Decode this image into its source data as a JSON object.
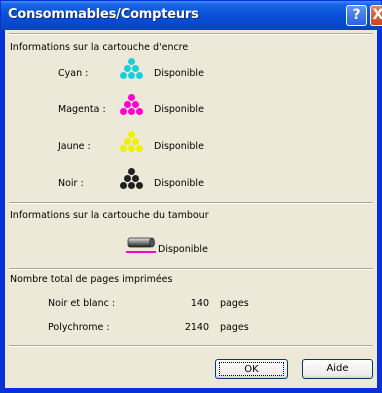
{
  "window": {
    "title": "Consommables/Compteurs",
    "help_glyph": "?",
    "close_glyph": "X"
  },
  "ink": {
    "section_title": "Informations sur la cartouche d'encre",
    "items": [
      {
        "label": "Cyan :",
        "status": "Disponible",
        "color": "#19d0dc"
      },
      {
        "label": "Magenta :",
        "status": "Disponible",
        "color": "#ff00d2"
      },
      {
        "label": "Jaune :",
        "status": "Disponible",
        "color": "#f0f000"
      },
      {
        "label": "Noir :",
        "status": "Disponible",
        "color": "#202020"
      }
    ]
  },
  "drum": {
    "section_title": "Informations sur la cartouche du tambour",
    "status": "Disponible",
    "accent_color": "#ff00d2"
  },
  "pages": {
    "section_title": "Nombre total de pages imprimées",
    "rows": [
      {
        "label": "Noir et blanc :",
        "value": "140",
        "unit": "pages"
      },
      {
        "label": "Polychrome :",
        "value": "2140",
        "unit": "pages"
      }
    ]
  },
  "buttons": {
    "ok": "OK",
    "help": "Aide"
  }
}
